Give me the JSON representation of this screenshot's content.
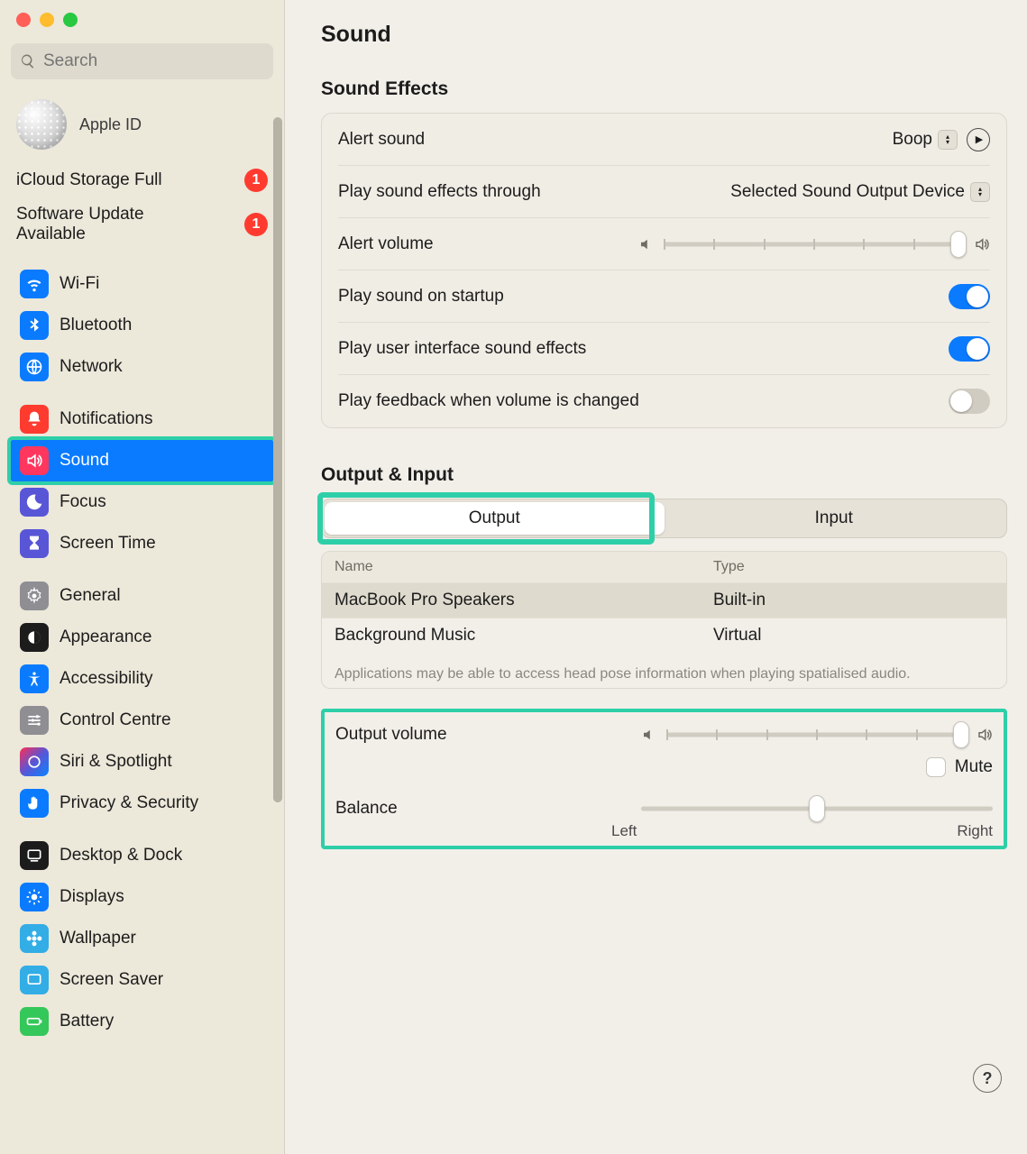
{
  "search": {
    "placeholder": "Search"
  },
  "account": {
    "name": "Apple ID"
  },
  "notices": [
    {
      "label": "iCloud Storage Full",
      "badge": "1"
    },
    {
      "label": "Software Update Available",
      "badge": "1"
    }
  ],
  "sidebar": {
    "g1": [
      {
        "label": "Wi-Fi"
      },
      {
        "label": "Bluetooth"
      },
      {
        "label": "Network"
      }
    ],
    "g2": [
      {
        "label": "Notifications"
      },
      {
        "label": "Sound"
      },
      {
        "label": "Focus"
      },
      {
        "label": "Screen Time"
      }
    ],
    "g3": [
      {
        "label": "General"
      },
      {
        "label": "Appearance"
      },
      {
        "label": "Accessibility"
      },
      {
        "label": "Control Centre"
      },
      {
        "label": "Siri & Spotlight"
      },
      {
        "label": "Privacy & Security"
      }
    ],
    "g4": [
      {
        "label": "Desktop & Dock"
      },
      {
        "label": "Displays"
      },
      {
        "label": "Wallpaper"
      },
      {
        "label": "Screen Saver"
      },
      {
        "label": "Battery"
      }
    ]
  },
  "page": {
    "title": "Sound",
    "effects_heading": "Sound Effects",
    "alert_sound_label": "Alert sound",
    "alert_sound_value": "Boop",
    "play_through_label": "Play sound effects through",
    "play_through_value": "Selected Sound Output Device",
    "alert_volume_label": "Alert volume",
    "alert_volume_pct": 98,
    "startup_label": "Play sound on startup",
    "startup_on": true,
    "ui_effects_label": "Play user interface sound effects",
    "ui_effects_on": true,
    "feedback_label": "Play feedback when volume is changed",
    "feedback_on": false,
    "oi_heading": "Output & Input",
    "tab_output": "Output",
    "tab_input": "Input",
    "col_name": "Name",
    "col_type": "Type",
    "devices": [
      {
        "name": "MacBook Pro Speakers",
        "type": "Built-in",
        "selected": true
      },
      {
        "name": "Background Music",
        "type": "Virtual",
        "selected": false
      }
    ],
    "hint": "Applications may be able to access head pose information when playing spatialised audio.",
    "output_volume_label": "Output volume",
    "output_volume_pct": 98,
    "mute_label": "Mute",
    "mute_checked": false,
    "balance_label": "Balance",
    "balance_pct": 50,
    "balance_left": "Left",
    "balance_right": "Right",
    "help": "?"
  }
}
